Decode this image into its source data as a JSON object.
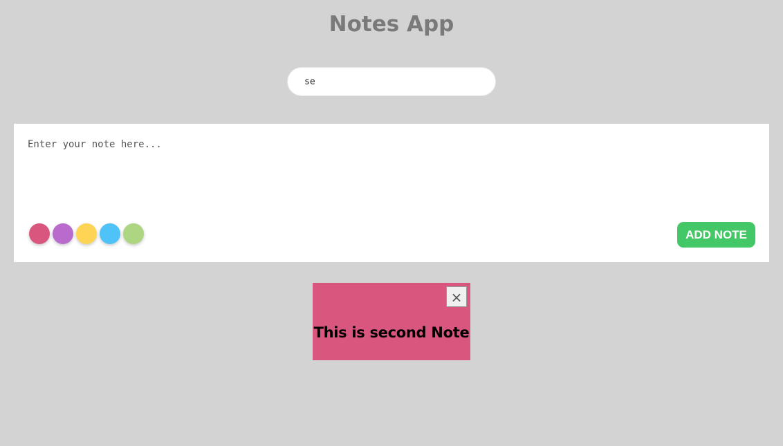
{
  "app": {
    "title": "Notes App"
  },
  "search": {
    "value": "se"
  },
  "composer": {
    "placeholder": "Enter your note here...",
    "colors": [
      "#d9577f",
      "#b86bcc",
      "#fdd453",
      "#4fc3f7",
      "#aed581"
    ],
    "add_button_label": "ADD NOTE",
    "add_button_color": "#44c767"
  },
  "notes": [
    {
      "text": "This is second Note",
      "color": "#d9577f",
      "close_glyph": "✕"
    }
  ]
}
